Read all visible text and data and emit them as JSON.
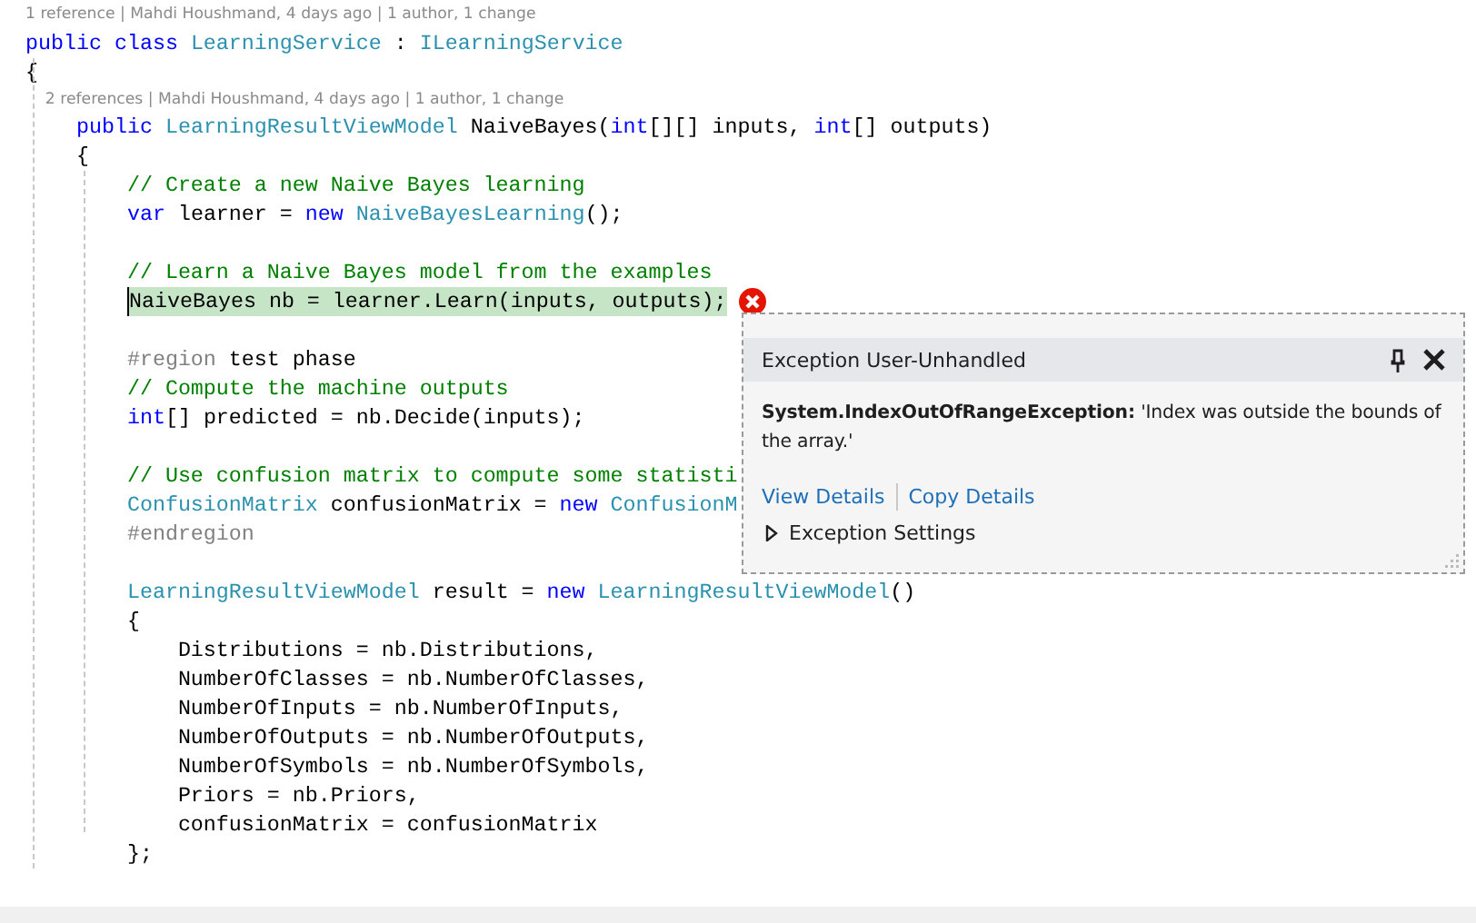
{
  "editor": {
    "lines": [
      {
        "kind": "codelens",
        "text": "1 reference | Mahdi Houshmand, 4 days ago | 1 author, 1 change"
      },
      {
        "kind": "code",
        "tokens": [
          {
            "kind": "keyword",
            "text": "public class "
          },
          {
            "kind": "type",
            "text": "LearningService"
          },
          {
            "kind": "plain",
            "text": " : "
          },
          {
            "kind": "type",
            "text": "ILearningService"
          }
        ]
      },
      {
        "kind": "code",
        "tokens": [
          {
            "kind": "plain",
            "text": "{"
          }
        ]
      },
      {
        "kind": "codelens",
        "text": "    2 references | Mahdi Houshmand, 4 days ago | 1 author, 1 change"
      },
      {
        "kind": "code",
        "tokens": [
          {
            "kind": "keyword",
            "text": "    public "
          },
          {
            "kind": "type",
            "text": "LearningResultViewModel"
          },
          {
            "kind": "plain",
            "text": " NaiveBayes("
          },
          {
            "kind": "keyword",
            "text": "int"
          },
          {
            "kind": "plain",
            "text": "[][] inputs, "
          },
          {
            "kind": "keyword",
            "text": "int"
          },
          {
            "kind": "plain",
            "text": "[] outputs)"
          }
        ]
      },
      {
        "kind": "code",
        "tokens": [
          {
            "kind": "plain",
            "text": "    {"
          }
        ]
      },
      {
        "kind": "code",
        "tokens": [
          {
            "kind": "comment",
            "text": "        // Create a new Naive Bayes learning"
          }
        ]
      },
      {
        "kind": "code",
        "tokens": [
          {
            "kind": "keyword",
            "text": "        var"
          },
          {
            "kind": "plain",
            "text": " learner = "
          },
          {
            "kind": "keyword",
            "text": "new "
          },
          {
            "kind": "type",
            "text": "NaiveBayesLearning"
          },
          {
            "kind": "plain",
            "text": "();"
          }
        ]
      },
      {
        "kind": "blank"
      },
      {
        "kind": "code",
        "tokens": [
          {
            "kind": "comment",
            "text": "        // Learn a Naive Bayes model from the examples"
          }
        ]
      },
      {
        "kind": "code",
        "highlighted": true,
        "error": true,
        "tokens": [
          {
            "kind": "plain",
            "text": "NaiveBayes nb = learner.Learn(inputs, outputs);"
          }
        ]
      },
      {
        "kind": "blank"
      },
      {
        "kind": "code",
        "tokens": [
          {
            "kind": "preproc",
            "text": "        #region"
          },
          {
            "kind": "plain",
            "text": " test phase"
          }
        ]
      },
      {
        "kind": "code",
        "tokens": [
          {
            "kind": "comment",
            "text": "        // Compute the machine outputs"
          }
        ]
      },
      {
        "kind": "code",
        "tokens": [
          {
            "kind": "keyword",
            "text": "        int"
          },
          {
            "kind": "plain",
            "text": "[] predicted = nb.Decide(inputs);"
          }
        ]
      },
      {
        "kind": "blank"
      },
      {
        "kind": "code",
        "tokens": [
          {
            "kind": "comment",
            "text": "        // Use confusion matrix to compute some statisti"
          }
        ]
      },
      {
        "kind": "code",
        "tokens": [
          {
            "kind": "type",
            "text": "        ConfusionMatrix"
          },
          {
            "kind": "plain",
            "text": " confusionMatrix = "
          },
          {
            "kind": "keyword",
            "text": "new "
          },
          {
            "kind": "type",
            "text": "ConfusionM"
          }
        ]
      },
      {
        "kind": "code",
        "tokens": [
          {
            "kind": "preproc",
            "text": "        #endregion"
          }
        ]
      },
      {
        "kind": "blank"
      },
      {
        "kind": "code",
        "tokens": [
          {
            "kind": "type",
            "text": "        LearningResultViewModel"
          },
          {
            "kind": "plain",
            "text": " result = "
          },
          {
            "kind": "keyword",
            "text": "new "
          },
          {
            "kind": "type",
            "text": "LearningResultViewModel"
          },
          {
            "kind": "plain",
            "text": "()"
          }
        ]
      },
      {
        "kind": "code",
        "tokens": [
          {
            "kind": "plain",
            "text": "        {"
          }
        ]
      },
      {
        "kind": "code",
        "tokens": [
          {
            "kind": "plain",
            "text": "            Distributions = nb.Distributions,"
          }
        ]
      },
      {
        "kind": "code",
        "tokens": [
          {
            "kind": "plain",
            "text": "            NumberOfClasses = nb.NumberOfClasses,"
          }
        ]
      },
      {
        "kind": "code",
        "tokens": [
          {
            "kind": "plain",
            "text": "            NumberOfInputs = nb.NumberOfInputs,"
          }
        ]
      },
      {
        "kind": "code",
        "tokens": [
          {
            "kind": "plain",
            "text": "            NumberOfOutputs = nb.NumberOfOutputs,"
          }
        ]
      },
      {
        "kind": "code",
        "tokens": [
          {
            "kind": "plain",
            "text": "            NumberOfSymbols = nb.NumberOfSymbols,"
          }
        ]
      },
      {
        "kind": "code",
        "tokens": [
          {
            "kind": "plain",
            "text": "            Priors = nb.Priors,"
          }
        ]
      },
      {
        "kind": "code",
        "tokens": [
          {
            "kind": "plain",
            "text": "            confusionMatrix = confusionMatrix"
          }
        ]
      },
      {
        "kind": "code",
        "tokens": [
          {
            "kind": "plain",
            "text": "        };"
          }
        ]
      }
    ]
  },
  "exception_popup": {
    "title": "Exception User-Unhandled",
    "message": "**System.IndexOutOfRangeException:** 'Index was outside the bounds of the array.'",
    "links": [
      "View Details",
      "Copy Details"
    ],
    "settings": {
      "label": "Exception Settings",
      "expanded": false
    }
  }
}
